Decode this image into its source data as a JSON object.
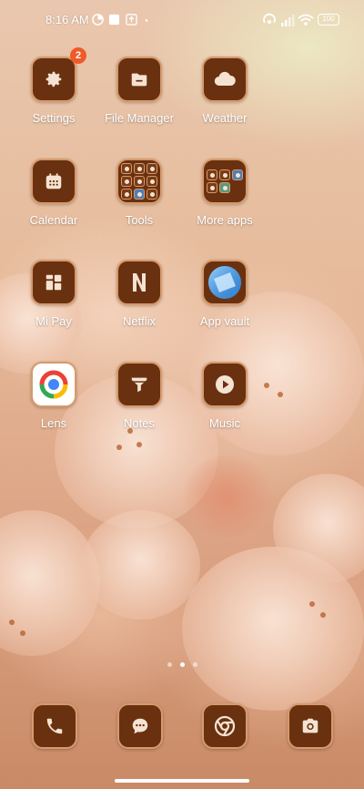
{
  "status_bar": {
    "time": "8:16 AM",
    "battery": "100"
  },
  "apps": {
    "settings": {
      "label": "Settings",
      "badge": "2",
      "icon": "gear-icon"
    },
    "file_manager": {
      "label": "File Manager",
      "icon": "folder-icon"
    },
    "weather": {
      "label": "Weather",
      "icon": "cloud-icon"
    },
    "calendar": {
      "label": "Calendar",
      "icon": "calendar-icon"
    },
    "tools": {
      "label": "Tools",
      "icon": "folder-grid-icon"
    },
    "more_apps": {
      "label": "More apps",
      "icon": "folder-grid-icon"
    },
    "mi_pay": {
      "label": "Mi Pay",
      "icon": "mi-pay-icon"
    },
    "netflix": {
      "label": "Netflix",
      "icon": "netflix-icon"
    },
    "app_vault": {
      "label": "App vault",
      "icon": "app-vault-icon"
    },
    "lens": {
      "label": "Lens",
      "icon": "lens-icon"
    },
    "notes": {
      "label": "Notes",
      "icon": "funnel-icon"
    },
    "music": {
      "label": "Music",
      "icon": "play-icon"
    }
  },
  "page_indicator": {
    "count": 3,
    "active": 2
  },
  "dock": {
    "phone": "phone-icon",
    "messages": "chat-icon",
    "browser": "chrome-icon",
    "camera": "camera-icon"
  },
  "colors": {
    "tile_background": "#6a3110",
    "tile_border": "#d79a6c",
    "badge": "#f05a28"
  }
}
